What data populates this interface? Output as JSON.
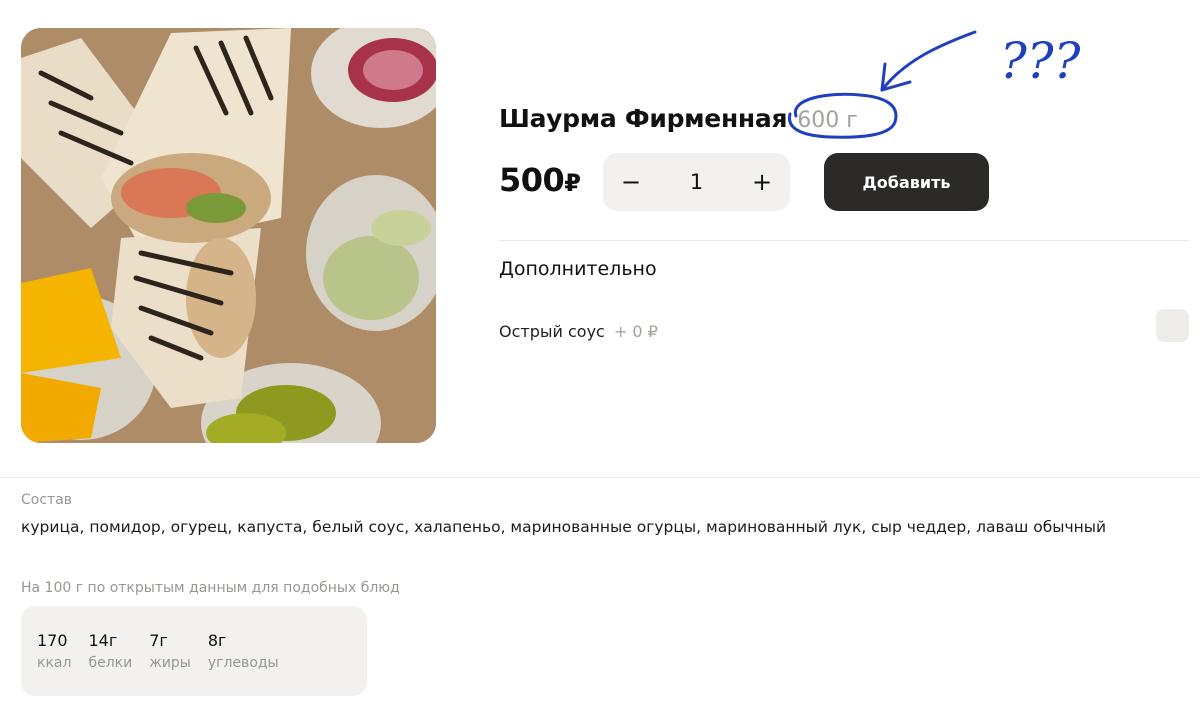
{
  "product": {
    "title": "Шаурма Фирменная",
    "weight": "600 г",
    "price": "500",
    "currency": "₽",
    "quantity": "1",
    "minus_label": "−",
    "plus_label": "+",
    "add_label": "Добавить"
  },
  "extras": {
    "heading": "Дополнительно",
    "options": [
      {
        "label": "Острый соус",
        "price": "+ 0 ₽",
        "checked": false
      }
    ]
  },
  "composition": {
    "heading": "Состав",
    "text": "курица, помидор, огурец, капуста, белый соус, халапеньо, маринованные огурцы, маринованный лук, сыр чеддер, лаваш обычный"
  },
  "nutrition": {
    "note": "На 100 г по открытым данным для подобных блюд",
    "items": [
      {
        "value": "170",
        "label": "ккал"
      },
      {
        "value": "14г",
        "label": "белки"
      },
      {
        "value": "7г",
        "label": "жиры"
      },
      {
        "value": "8г",
        "label": "углеводы"
      }
    ]
  },
  "annotation": {
    "text": "???",
    "color": "#1f3fbf"
  },
  "colors": {
    "add_button_bg": "#2b2a29",
    "stepper_bg": "#f3f1ef",
    "muted_text": "#a4a09c"
  }
}
